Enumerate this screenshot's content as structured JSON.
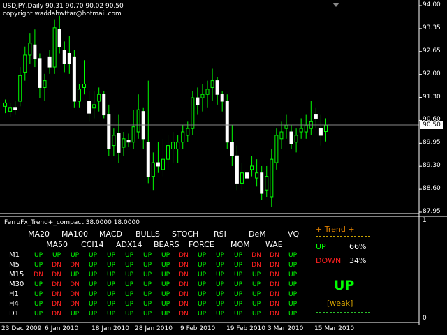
{
  "header": {
    "line1": "USDJPY,Daily  90.31 90.70 90.02 90.50",
    "line2": "copyright waddahwttar@hotmail.com"
  },
  "price_axis": {
    "labels": [
      "94.00",
      "93.35",
      "92.65",
      "92.00",
      "91.30",
      "90.60",
      "89.95",
      "89.30",
      "88.60",
      "87.95"
    ],
    "current": "90.50"
  },
  "time_axis": {
    "labels": [
      "23 Dec 2009",
      "6 Jan 2010",
      "18 Jan 2010",
      "28 Jan 2010",
      "9 Feb 2010",
      "19 Feb 2010",
      "3 Mar 2010",
      "15 Mar 2010"
    ]
  },
  "indicator": {
    "name": "FerruFx_Trend+_compact 38.0000 18.0000",
    "scale_top": "1",
    "scale_bottom": "0",
    "headers_row1": [
      "MA20",
      "MA100",
      "MACD",
      "BULLS",
      "STOCH",
      "RSI",
      "DeM",
      "VQ"
    ],
    "headers_row2": [
      "MA50",
      "CCI14",
      "ADX14",
      "BEARS",
      "FORCE",
      "MOM",
      "WAE"
    ],
    "timeframes": [
      "M1",
      "M5",
      "M15",
      "M30",
      "H1",
      "H4",
      "D1"
    ],
    "grid": [
      [
        "UP",
        "UP",
        "UP",
        "UP",
        "UP",
        "UP",
        "UP",
        "UP",
        "DN",
        "UP",
        "UP",
        "UP",
        "DN",
        "DN",
        "UP"
      ],
      [
        "UP",
        "DN",
        "DN",
        "UP",
        "UP",
        "UP",
        "UP",
        "UP",
        "DN",
        "UP",
        "UP",
        "UP",
        "DN",
        "DN",
        "UP"
      ],
      [
        "DN",
        "DN",
        "UP",
        "UP",
        "UP",
        "UP",
        "UP",
        "UP",
        "DN",
        "UP",
        "UP",
        "UP",
        "UP",
        "DN",
        "UP"
      ],
      [
        "UP",
        "DN",
        "DN",
        "UP",
        "UP",
        "UP",
        "UP",
        "UP",
        "DN",
        "UP",
        "UP",
        "UP",
        "UP",
        "DN",
        "UP"
      ],
      [
        "UP",
        "DN",
        "DN",
        "UP",
        "UP",
        "UP",
        "UP",
        "UP",
        "DN",
        "UP",
        "UP",
        "UP",
        "UP",
        "DN",
        "UP"
      ],
      [
        "UP",
        "DN",
        "DN",
        "UP",
        "UP",
        "UP",
        "UP",
        "UP",
        "DN",
        "UP",
        "UP",
        "UP",
        "UP",
        "DN",
        "UP"
      ],
      [
        "UP",
        "DN",
        "UP",
        "UP",
        "UP",
        "UP",
        "UP",
        "UP",
        "DN",
        "UP",
        "UP",
        "UP",
        "UP",
        "DN",
        "UP"
      ]
    ],
    "trend_title": "+ Trend +",
    "up_label": "UP",
    "up_pct": "66%",
    "down_label": "DOWN",
    "down_pct": "34%",
    "signal": "UP",
    "strength": "[weak]"
  },
  "colors": {
    "up": "#00ff00",
    "down": "#ff2020",
    "trend": "#e08000"
  },
  "chart_data": {
    "type": "candlestick",
    "ylim": [
      87.95,
      94.0
    ],
    "candles": [
      {
        "o": 91.05,
        "h": 91.25,
        "l": 90.85,
        "c": 91.15
      },
      {
        "o": 90.9,
        "h": 91.15,
        "l": 90.75,
        "c": 91.0
      },
      {
        "o": 91.0,
        "h": 91.2,
        "l": 90.8,
        "c": 90.95
      },
      {
        "o": 91.2,
        "h": 92.2,
        "l": 91.05,
        "c": 91.95
      },
      {
        "o": 92.05,
        "h": 92.8,
        "l": 91.8,
        "c": 92.55
      },
      {
        "o": 92.55,
        "h": 93.2,
        "l": 92.3,
        "c": 92.9
      },
      {
        "o": 92.85,
        "h": 93.3,
        "l": 92.2,
        "c": 92.45
      },
      {
        "o": 92.45,
        "h": 92.6,
        "l": 91.3,
        "c": 91.6
      },
      {
        "o": 91.6,
        "h": 92.0,
        "l": 91.2,
        "c": 91.8
      },
      {
        "o": 92.5,
        "h": 92.7,
        "l": 92.0,
        "c": 92.2
      },
      {
        "o": 92.2,
        "h": 93.6,
        "l": 92.0,
        "c": 93.35
      },
      {
        "o": 93.3,
        "h": 93.7,
        "l": 92.6,
        "c": 92.8
      },
      {
        "o": 92.7,
        "h": 92.95,
        "l": 92.05,
        "c": 92.3
      },
      {
        "o": 92.6,
        "h": 93.1,
        "l": 92.0,
        "c": 92.3
      },
      {
        "o": 92.5,
        "h": 92.7,
        "l": 91.0,
        "c": 91.2
      },
      {
        "o": 91.2,
        "h": 91.7,
        "l": 91.0,
        "c": 91.55
      },
      {
        "o": 91.6,
        "h": 92.4,
        "l": 91.4,
        "c": 91.7
      },
      {
        "o": 91.2,
        "h": 91.5,
        "l": 90.6,
        "c": 90.85
      },
      {
        "o": 91.0,
        "h": 91.5,
        "l": 90.7,
        "c": 91.1
      },
      {
        "o": 91.2,
        "h": 91.6,
        "l": 90.9,
        "c": 91.4
      },
      {
        "o": 91.4,
        "h": 91.5,
        "l": 90.7,
        "c": 90.8
      },
      {
        "o": 90.8,
        "h": 91.1,
        "l": 89.6,
        "c": 89.8
      },
      {
        "o": 89.9,
        "h": 90.4,
        "l": 89.6,
        "c": 90.2
      },
      {
        "o": 90.25,
        "h": 90.8,
        "l": 89.4,
        "c": 89.7
      },
      {
        "o": 89.85,
        "h": 90.3,
        "l": 89.6,
        "c": 90.1
      },
      {
        "o": 90.05,
        "h": 90.25,
        "l": 89.85,
        "c": 90.0
      },
      {
        "o": 90.0,
        "h": 90.95,
        "l": 89.8,
        "c": 90.45
      },
      {
        "o": 90.3,
        "h": 91.4,
        "l": 90.1,
        "c": 90.95
      },
      {
        "o": 90.9,
        "h": 91.0,
        "l": 89.8,
        "c": 90.1
      },
      {
        "o": 90.0,
        "h": 91.8,
        "l": 88.8,
        "c": 89.0
      },
      {
        "o": 89.0,
        "h": 89.7,
        "l": 88.6,
        "c": 89.4
      },
      {
        "o": 89.4,
        "h": 90.0,
        "l": 89.1,
        "c": 89.3
      },
      {
        "o": 89.2,
        "h": 90.1,
        "l": 89.0,
        "c": 89.5
      },
      {
        "o": 89.5,
        "h": 90.2,
        "l": 89.2,
        "c": 89.9
      },
      {
        "o": 89.8,
        "h": 90.3,
        "l": 89.4,
        "c": 90.0
      },
      {
        "o": 89.8,
        "h": 90.2,
        "l": 89.4,
        "c": 90.0
      },
      {
        "o": 90.0,
        "h": 90.5,
        "l": 89.8,
        "c": 90.3
      },
      {
        "o": 90.2,
        "h": 90.6,
        "l": 90.0,
        "c": 90.4
      },
      {
        "o": 90.4,
        "h": 91.5,
        "l": 90.2,
        "c": 91.3
      },
      {
        "o": 91.3,
        "h": 91.6,
        "l": 90.8,
        "c": 91.1
      },
      {
        "o": 91.3,
        "h": 91.7,
        "l": 90.9,
        "c": 91.4
      },
      {
        "o": 91.4,
        "h": 91.8,
        "l": 91.0,
        "c": 91.55
      },
      {
        "o": 91.6,
        "h": 92.15,
        "l": 91.2,
        "c": 91.8
      },
      {
        "o": 91.8,
        "h": 91.9,
        "l": 91.1,
        "c": 91.4
      },
      {
        "o": 91.4,
        "h": 91.5,
        "l": 90.9,
        "c": 91.2
      },
      {
        "o": 91.2,
        "h": 91.4,
        "l": 89.8,
        "c": 90.0
      },
      {
        "o": 90.0,
        "h": 90.5,
        "l": 89.3,
        "c": 89.6
      },
      {
        "o": 89.6,
        "h": 89.9,
        "l": 88.6,
        "c": 88.8
      },
      {
        "o": 88.8,
        "h": 89.4,
        "l": 88.6,
        "c": 89.1
      },
      {
        "o": 89.1,
        "h": 89.5,
        "l": 88.8,
        "c": 88.95
      },
      {
        "o": 89.2,
        "h": 89.6,
        "l": 89.0,
        "c": 89.3
      },
      {
        "o": 88.95,
        "h": 89.5,
        "l": 88.7,
        "c": 89.1
      },
      {
        "o": 89.1,
        "h": 89.3,
        "l": 88.3,
        "c": 88.5
      },
      {
        "o": 88.6,
        "h": 89.3,
        "l": 88.4,
        "c": 89.0
      },
      {
        "o": 88.4,
        "h": 89.8,
        "l": 88.1,
        "c": 89.5
      },
      {
        "o": 89.4,
        "h": 90.4,
        "l": 89.2,
        "c": 90.2
      },
      {
        "o": 90.1,
        "h": 90.6,
        "l": 89.8,
        "c": 90.3
      },
      {
        "o": 90.4,
        "h": 90.8,
        "l": 90.1,
        "c": 90.5
      },
      {
        "o": 90.3,
        "h": 90.5,
        "l": 89.8,
        "c": 89.95
      },
      {
        "o": 90.0,
        "h": 90.4,
        "l": 89.7,
        "c": 90.2
      },
      {
        "o": 90.3,
        "h": 90.7,
        "l": 90.1,
        "c": 90.4
      },
      {
        "o": 90.3,
        "h": 90.8,
        "l": 90.1,
        "c": 90.5
      },
      {
        "o": 90.4,
        "h": 91.2,
        "l": 90.2,
        "c": 90.6
      },
      {
        "o": 90.8,
        "h": 91.0,
        "l": 90.4,
        "c": 90.7
      },
      {
        "o": 90.4,
        "h": 90.8,
        "l": 89.9,
        "c": 90.2
      },
      {
        "o": 90.31,
        "h": 90.7,
        "l": 90.02,
        "c": 90.5
      }
    ]
  }
}
